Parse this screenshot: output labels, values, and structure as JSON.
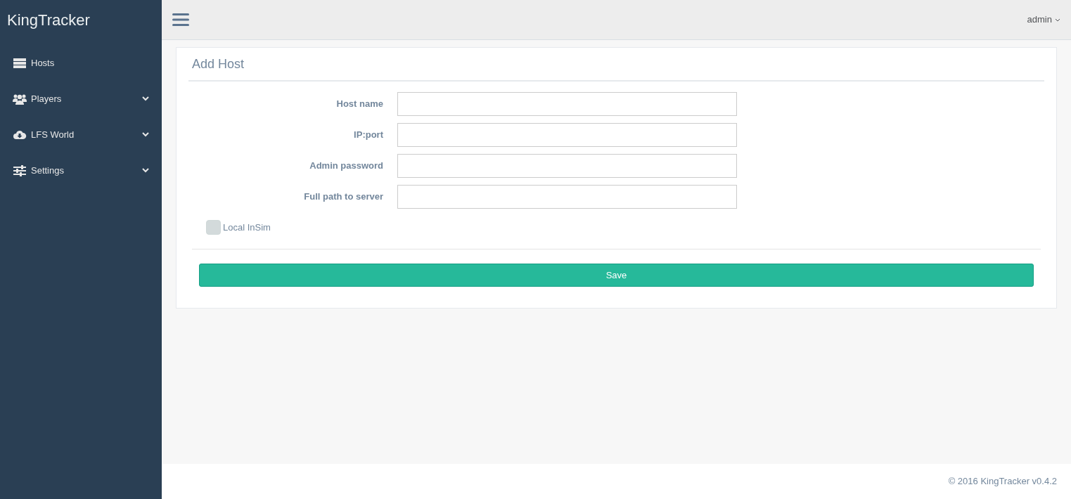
{
  "brand": "KingTracker",
  "sidebar": {
    "items": [
      {
        "label": "Hosts",
        "has_submenu": false
      },
      {
        "label": "Players",
        "has_submenu": true
      },
      {
        "label": "LFS World",
        "has_submenu": true
      },
      {
        "label": "Settings",
        "has_submenu": true
      }
    ]
  },
  "topbar": {
    "user": "admin"
  },
  "panel": {
    "title": "Add Host",
    "fields": [
      {
        "label": "Host name"
      },
      {
        "label": "IP:port"
      },
      {
        "label": "Admin password"
      },
      {
        "label": "Full path to server"
      }
    ],
    "checkbox": {
      "label": "Local InSim",
      "checked": false
    },
    "button": "Save"
  },
  "footer": "© 2016 KingTracker v0.4.2"
}
